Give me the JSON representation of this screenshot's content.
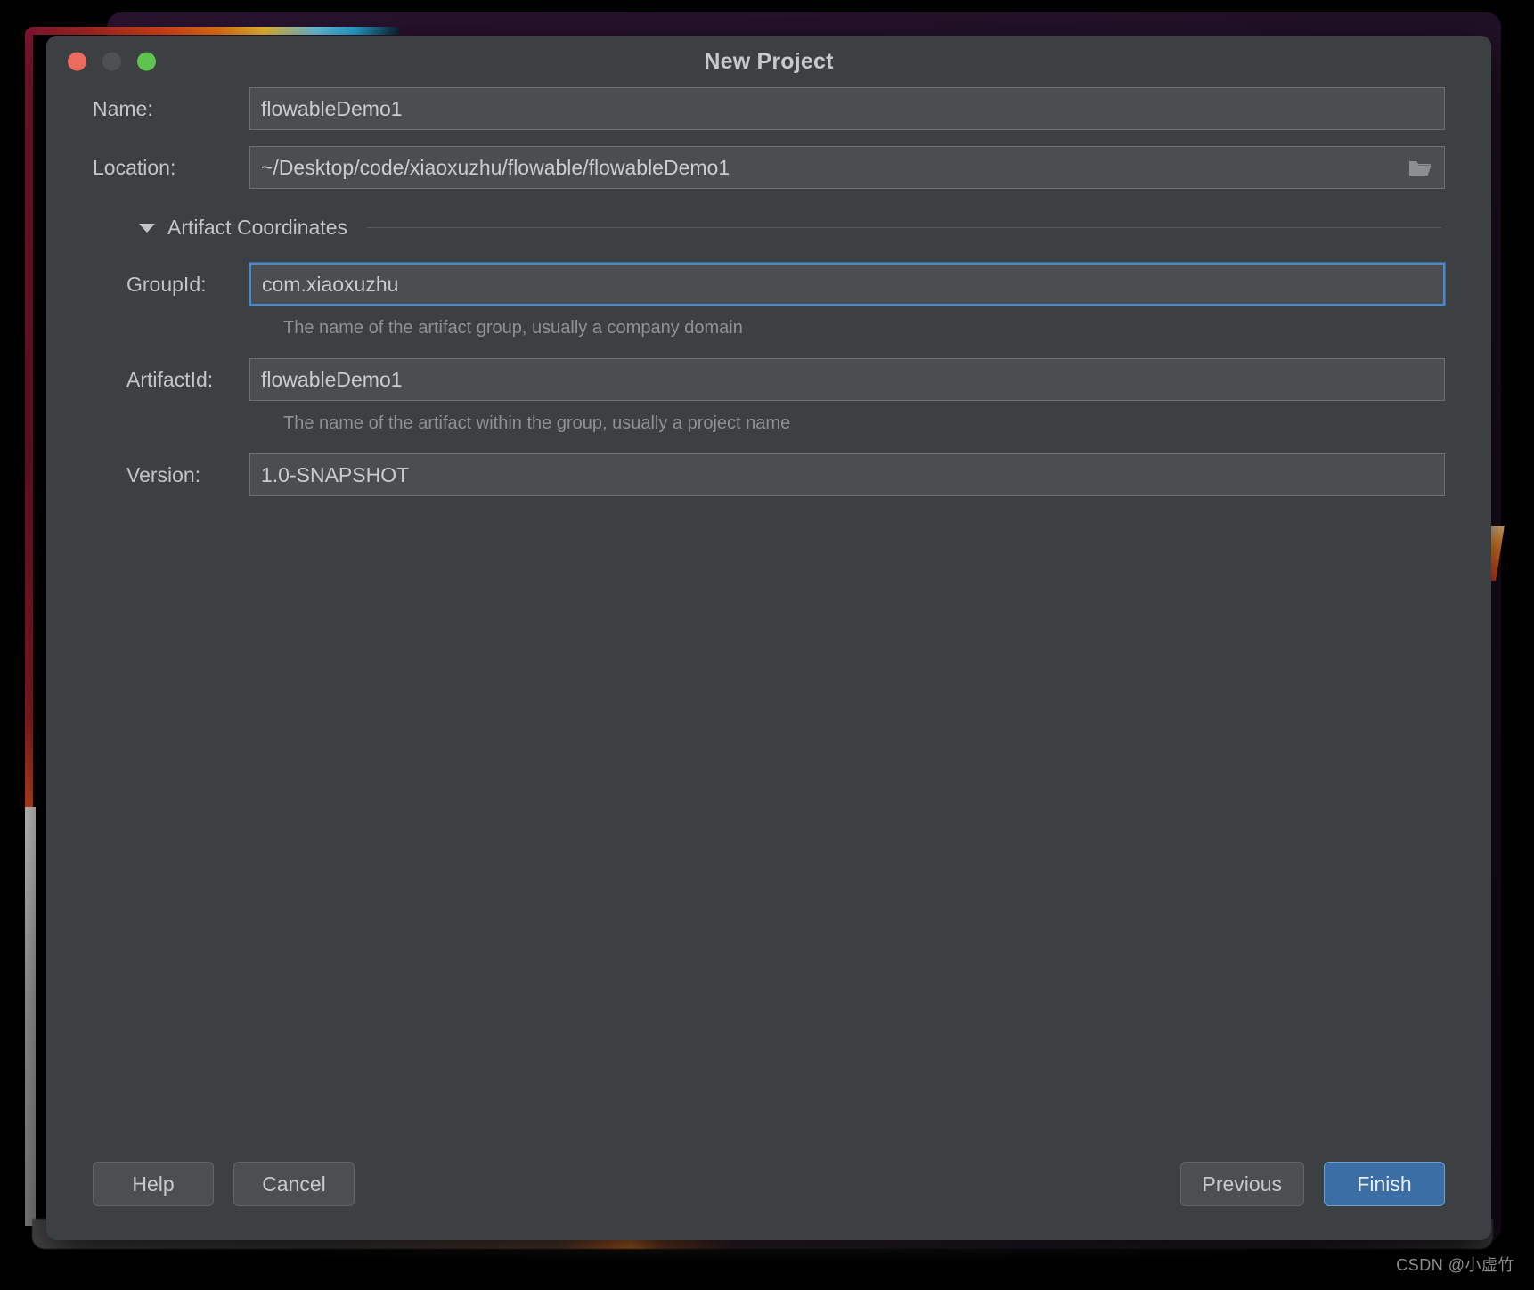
{
  "window": {
    "title": "New Project",
    "traffic_lights": [
      {
        "name": "close",
        "color": "#ec6a5e"
      },
      {
        "name": "minimize",
        "color": "#4d5154"
      },
      {
        "name": "zoom",
        "color": "#5fc44f"
      }
    ]
  },
  "form": {
    "name": {
      "label": "Name:",
      "value": "flowableDemo1"
    },
    "location": {
      "label": "Location:",
      "value": "~/Desktop/code/xiaoxuzhu/flowable/flowableDemo1",
      "browse_icon": "folder-icon"
    }
  },
  "section": {
    "title": "Artifact Coordinates",
    "expanded": true,
    "toggle_icon": "triangle-down-icon"
  },
  "artifact": {
    "group_id": {
      "label": "GroupId:",
      "value": "com.xiaoxuzhu",
      "hint": "The name of the artifact group, usually a company domain",
      "focused": true
    },
    "artifact_id": {
      "label": "ArtifactId:",
      "value": "flowableDemo1",
      "hint": "The name of the artifact within the group, usually a project name",
      "focused": false
    },
    "version": {
      "label": "Version:",
      "value": "1.0-SNAPSHOT",
      "focused": false
    }
  },
  "footer": {
    "help": "Help",
    "cancel": "Cancel",
    "previous": "Previous",
    "finish": "Finish"
  },
  "watermark": "CSDN @小虚竹",
  "colors": {
    "dialog_bg": "#3c4042",
    "field_bg": "#4a4e50",
    "field_border": "#6d7174",
    "focus_border": "#4a88c7",
    "text": "#c3c6c8",
    "hint_text": "#8e9295",
    "primary_button": "#3a6ea5"
  }
}
